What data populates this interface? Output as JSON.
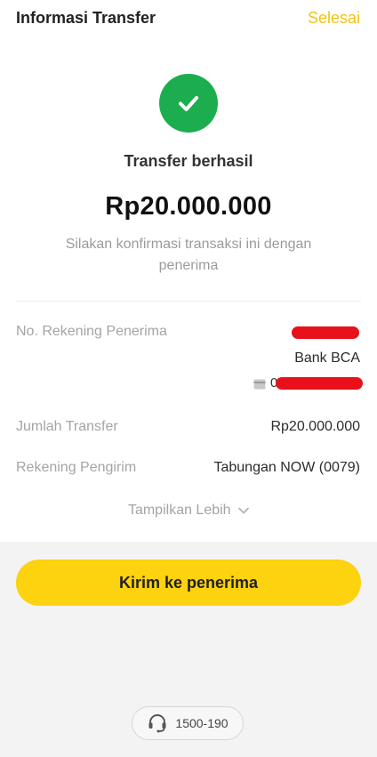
{
  "header": {
    "title": "Informasi Transfer",
    "done_label": "Selesai"
  },
  "status": {
    "text": "Transfer berhasil",
    "amount": "Rp20.000.000",
    "note": "Silakan konfirmasi transaksi ini dengan penerima"
  },
  "details": {
    "recipient_account_label": "No. Rekening Penerima",
    "bank_name": "Bank BCA",
    "account_prefix": "0",
    "amount_label": "Jumlah Transfer",
    "amount_value": "Rp20.000.000",
    "sender_label": "Rekening Pengirim",
    "sender_value": "Tabungan NOW (0079)",
    "show_more": "Tampilkan Lebih"
  },
  "actions": {
    "send_label": "Kirim ke penerima"
  },
  "help": {
    "phone": "1500-190"
  },
  "colors": {
    "accent": "#fdd20e",
    "done_text": "#f1c40f",
    "success": "#1cae4e",
    "redaction": "#e8101a"
  },
  "icons": [
    "check-icon",
    "bank-card-icon",
    "chevron-down-icon",
    "headset-icon"
  ]
}
